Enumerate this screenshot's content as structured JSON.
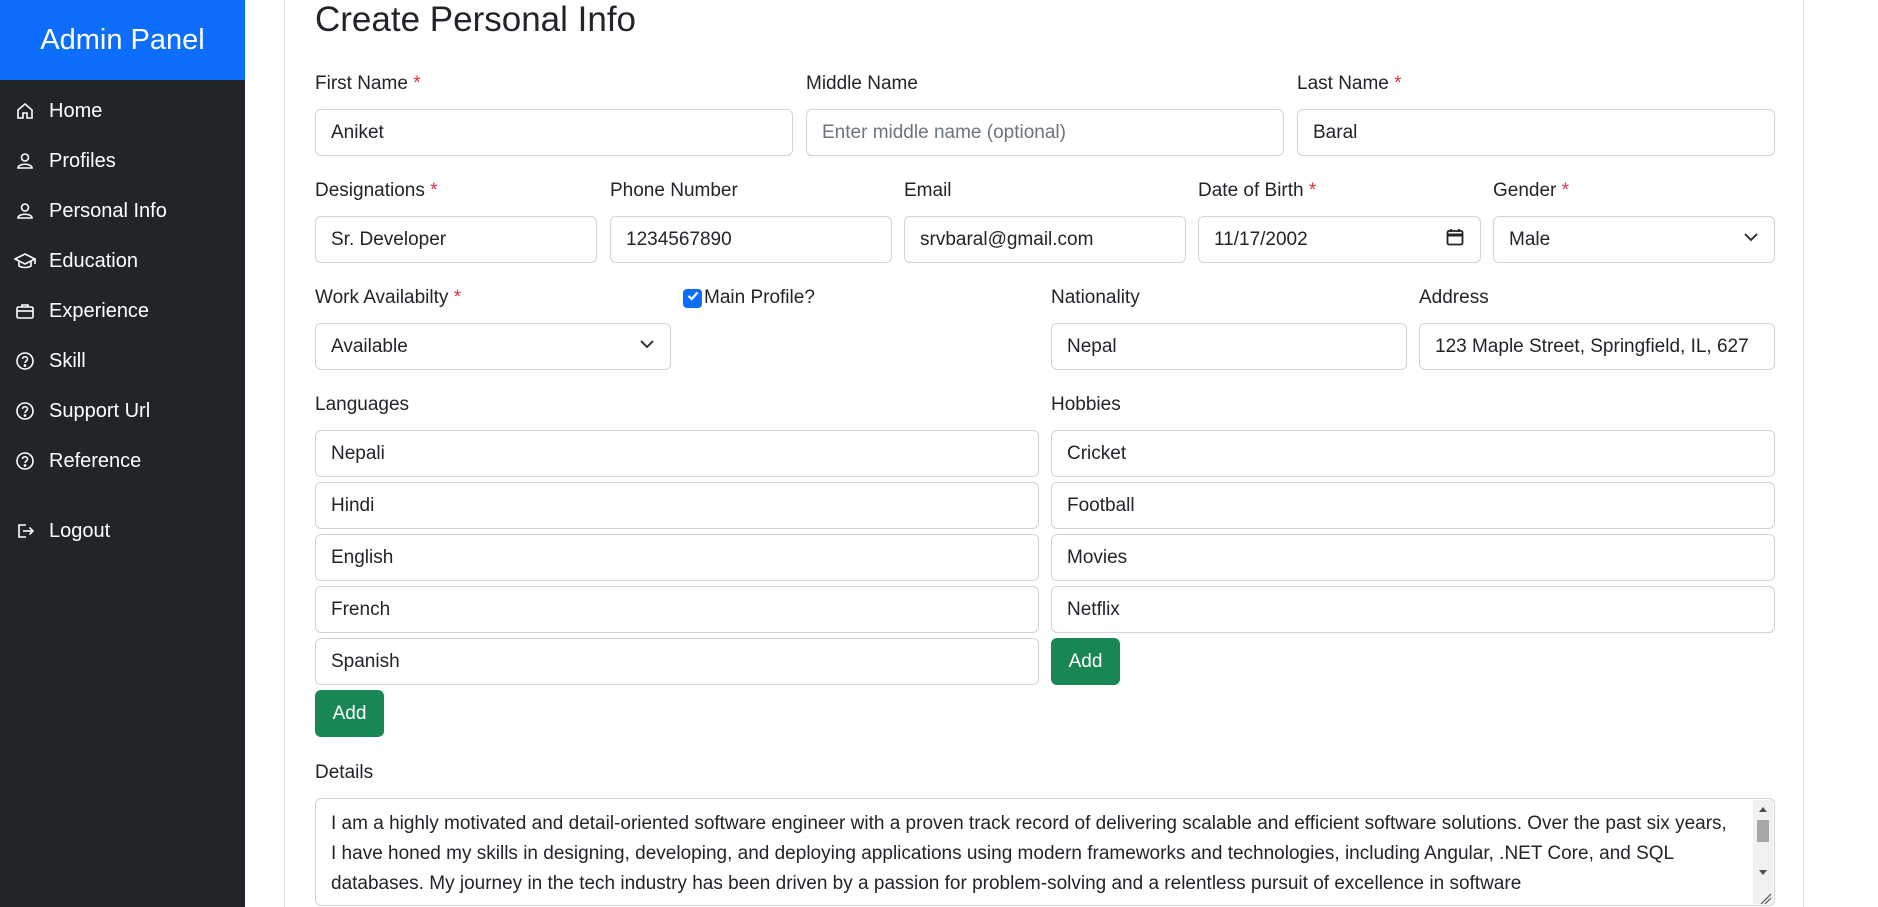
{
  "sidebar": {
    "brand": "Admin Panel",
    "items": [
      {
        "label": "Home",
        "icon": "home-icon"
      },
      {
        "label": "Profiles",
        "icon": "person-icon"
      },
      {
        "label": "Personal Info",
        "icon": "person-icon"
      },
      {
        "label": "Education",
        "icon": "graduation-cap-icon"
      },
      {
        "label": "Experience",
        "icon": "briefcase-icon"
      },
      {
        "label": "Skill",
        "icon": "question-circle-icon"
      },
      {
        "label": "Support Url",
        "icon": "question-circle-icon"
      },
      {
        "label": "Reference",
        "icon": "question-circle-icon"
      },
      {
        "label": "Logout",
        "icon": "logout-icon"
      }
    ]
  },
  "form": {
    "title": "Create Personal Info",
    "required_mark": "*",
    "first_name": {
      "label": "First Name",
      "value": "Aniket"
    },
    "middle_name": {
      "label": "Middle Name",
      "value": "",
      "placeholder": "Enter middle name (optional)"
    },
    "last_name": {
      "label": "Last Name",
      "value": "Baral"
    },
    "designation": {
      "label": "Designations",
      "value": "Sr. Developer"
    },
    "phone": {
      "label": "Phone Number",
      "value": "1234567890"
    },
    "email": {
      "label": "Email",
      "value": "srvbaral@gmail.com"
    },
    "dob": {
      "label": "Date of Birth",
      "value": "11/17/2002"
    },
    "gender": {
      "label": "Gender",
      "value": "Male"
    },
    "work_availability": {
      "label": "Work Availabilty",
      "value": "Available"
    },
    "main_profile": {
      "label": "Main Profile?",
      "checked": true
    },
    "nationality": {
      "label": "Nationality",
      "value": "Nepal"
    },
    "address": {
      "label": "Address",
      "value": "123 Maple Street, Springfield, IL, 627"
    },
    "languages": {
      "label": "Languages",
      "items": [
        "Nepali",
        "Hindi",
        "English",
        "French",
        "Spanish"
      ],
      "add_label": "Add"
    },
    "hobbies": {
      "label": "Hobbies",
      "items": [
        "Cricket",
        "Football",
        "Movies",
        "Netflix"
      ],
      "add_label": "Add"
    },
    "details": {
      "label": "Details",
      "value": "I am a highly motivated and detail-oriented software engineer with a proven track record of delivering scalable and efficient software solutions. Over the past six years, I have honed my skills in designing, developing, and deploying applications using modern frameworks and technologies, including Angular, .NET Core, and SQL databases. My journey in the tech industry has been driven by a passion for problem-solving and a relentless pursuit of excellence in software"
    }
  },
  "colors": {
    "brand": "#0d6efd",
    "sidebar": "#212529",
    "add_button": "#198754",
    "required": "#dc3545"
  }
}
